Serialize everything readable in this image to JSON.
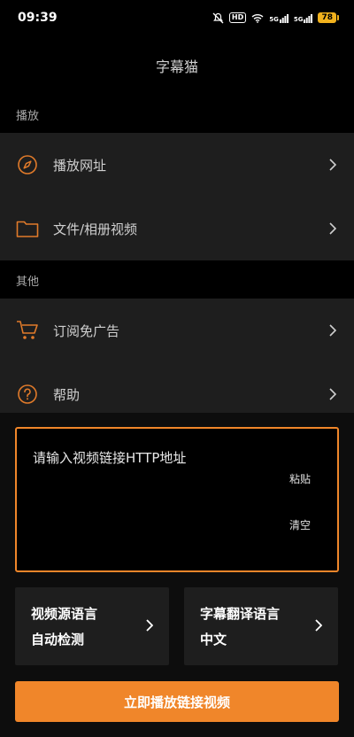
{
  "status_bar": {
    "time": "09:39",
    "hd": "HD",
    "signal1": "5G",
    "signal2": "5G",
    "battery": "78"
  },
  "app": {
    "title": "字幕猫"
  },
  "sections": [
    {
      "header": "播放",
      "items": [
        {
          "label": "播放网址",
          "icon": "compass-icon"
        },
        {
          "label": "文件/相册视频",
          "icon": "folder-icon"
        }
      ]
    },
    {
      "header": "其他",
      "items": [
        {
          "label": "订阅免广告",
          "icon": "cart-icon"
        },
        {
          "label": "帮助",
          "icon": "help-icon"
        }
      ]
    }
  ],
  "url_input": {
    "placeholder": "请输入视频链接HTTP地址",
    "paste_label": "粘贴",
    "clear_label": "清空"
  },
  "source_language": {
    "title": "视频源语言",
    "value": "自动检测"
  },
  "translate_language": {
    "title": "字幕翻译语言",
    "value": "中文"
  },
  "play_button": {
    "label": "立即播放链接视频"
  },
  "colors": {
    "accent": "#f0862a",
    "background": "#000000",
    "card": "#1e1e1e",
    "battery": "#f2b21d"
  }
}
